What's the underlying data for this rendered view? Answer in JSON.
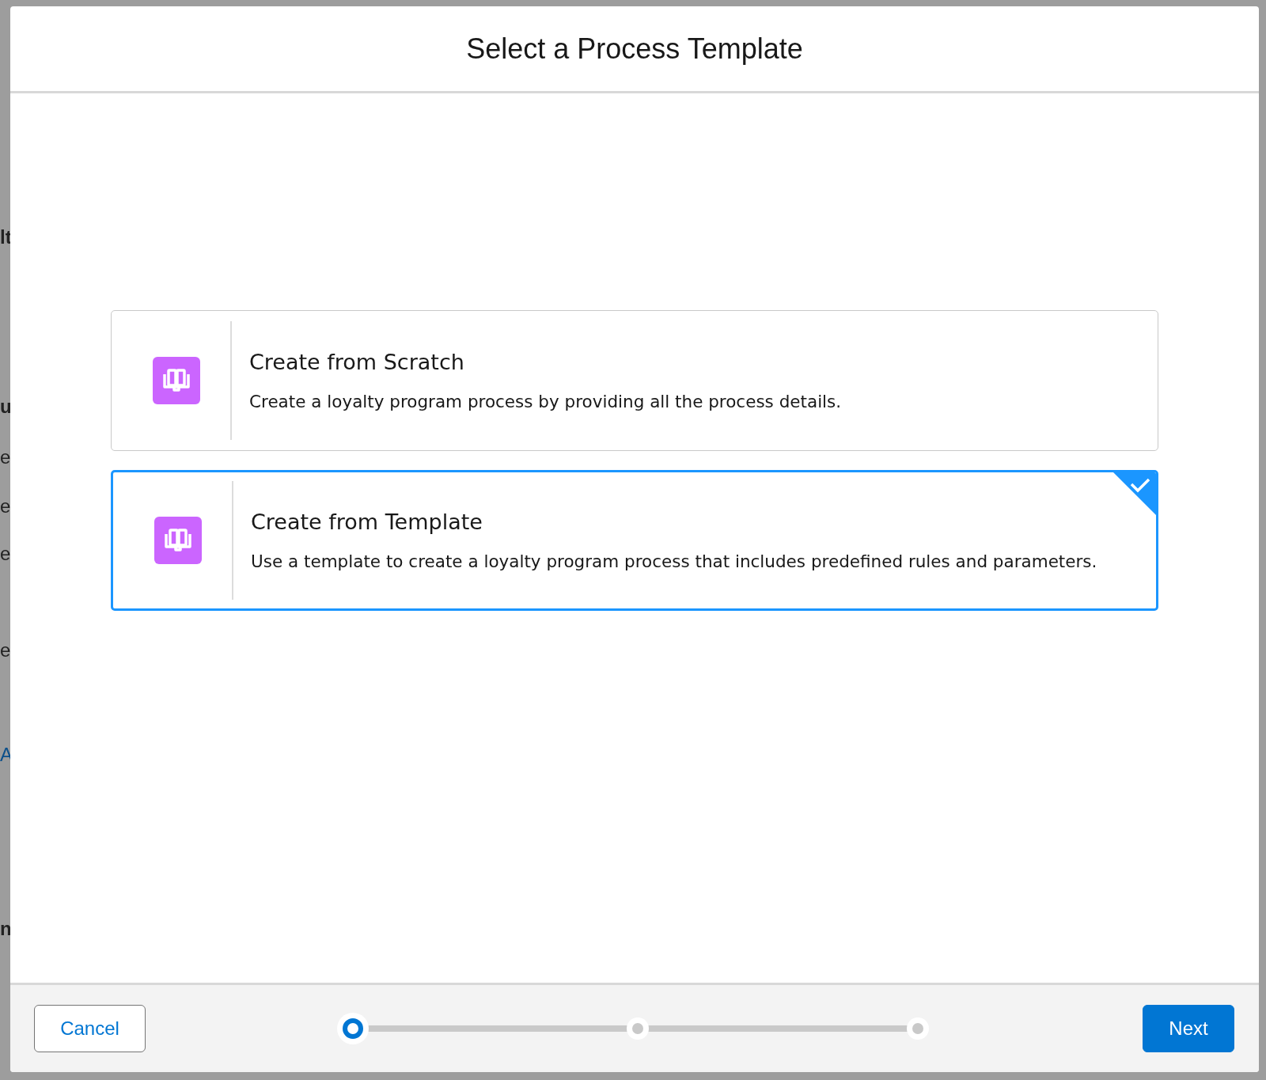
{
  "background": {
    "side_fragments": [
      {
        "text": "lt",
        "kind": "heading"
      },
      {
        "text": "u",
        "kind": "heading"
      },
      {
        "text": "e",
        "kind": "text"
      },
      {
        "text": "e",
        "kind": "text"
      },
      {
        "text": "e",
        "kind": "text"
      },
      {
        "text": "e",
        "kind": "text"
      },
      {
        "text": "A",
        "kind": "link"
      },
      {
        "text": "n",
        "kind": "heading"
      }
    ]
  },
  "modal": {
    "title": "Select a Process Template",
    "options": [
      {
        "title": "Create from Scratch",
        "description": "Create a loyalty program process by providing all the process details.",
        "selected": false
      },
      {
        "title": "Create from Template",
        "description": "Use a template to create a loyalty program process that includes predefined rules and parameters.",
        "selected": true
      }
    ],
    "steps": [
      {
        "selected": true
      },
      {
        "selected": false
      },
      {
        "selected": false
      }
    ],
    "cancel_button": "Cancel",
    "next_button": "Next"
  }
}
